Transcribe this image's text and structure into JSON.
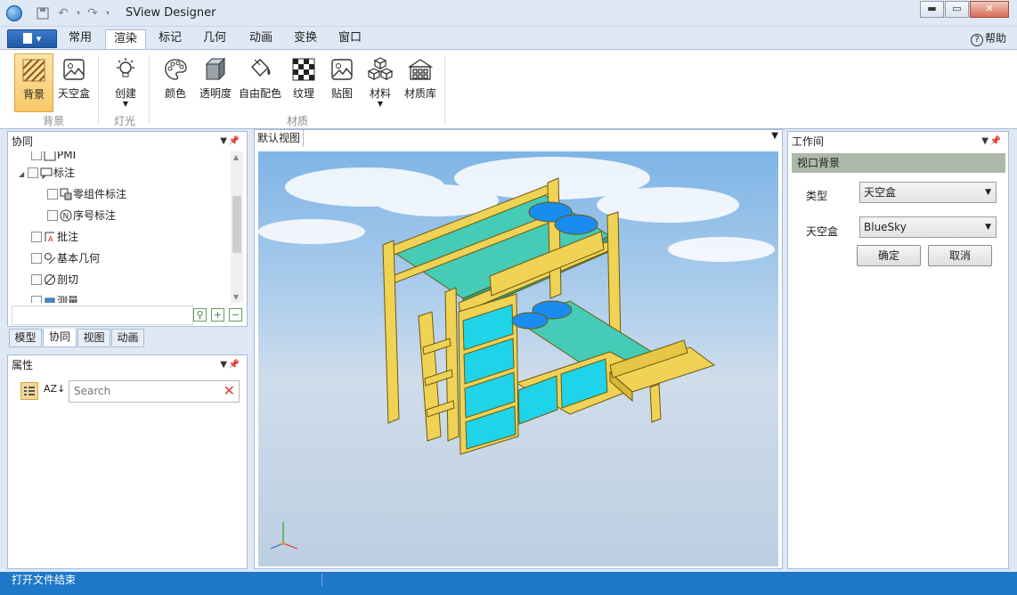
{
  "window": {
    "title": "SView Designer",
    "minimize_glyph": "▬",
    "maximize_glyph": "▭",
    "close_glyph": "✕"
  },
  "menu": {
    "tabs": [
      "常用",
      "渲染",
      "标记",
      "几何",
      "动画",
      "变换",
      "窗口"
    ],
    "active_tab": "渲染",
    "help": "帮助"
  },
  "ribbon": {
    "buttons": {
      "background": "背景",
      "skybox": "天空盒",
      "create": "创建",
      "color": "颜色",
      "transparency": "透明度",
      "free_color": "自由配色",
      "texture": "纹理",
      "decal": "贴图",
      "material": "材料",
      "material_lib": "材质库"
    },
    "groups": {
      "background": "背景",
      "light": "灯光",
      "material": "材质"
    }
  },
  "tree_panel": {
    "title": "协同",
    "items": [
      {
        "label": "PMI",
        "level": 1
      },
      {
        "label": "标注",
        "level": 1,
        "expanded": true
      },
      {
        "label": "零组件标注",
        "level": 2
      },
      {
        "label": "序号标注",
        "level": 2
      },
      {
        "label": "批注",
        "level": 1
      },
      {
        "label": "基本几何",
        "level": 1
      },
      {
        "label": "剖切",
        "level": 1
      },
      {
        "label": "测量",
        "level": 1
      }
    ]
  },
  "bottom_tabs": {
    "tabs": [
      "模型",
      "协同",
      "视图",
      "动画"
    ],
    "active": "协同"
  },
  "properties": {
    "title": "属性",
    "sort_label": "AZ",
    "search_placeholder": "Search"
  },
  "viewport": {
    "tab": "默认视图"
  },
  "work_panel": {
    "title": "工作间",
    "section": "视口背景",
    "type_label": "类型",
    "type_value": "天空盒",
    "skybox_label": "天空盒",
    "skybox_value": "BlueSky",
    "ok": "确定",
    "cancel": "取消"
  },
  "status": {
    "message": "打开文件结束"
  },
  "colors": {
    "accent": "#1e78c8",
    "bed_frame": "#f0d255",
    "bed_mattress": "#45cbb6",
    "drawer": "#1fd3e8",
    "pillow": "#1a8cf0"
  }
}
